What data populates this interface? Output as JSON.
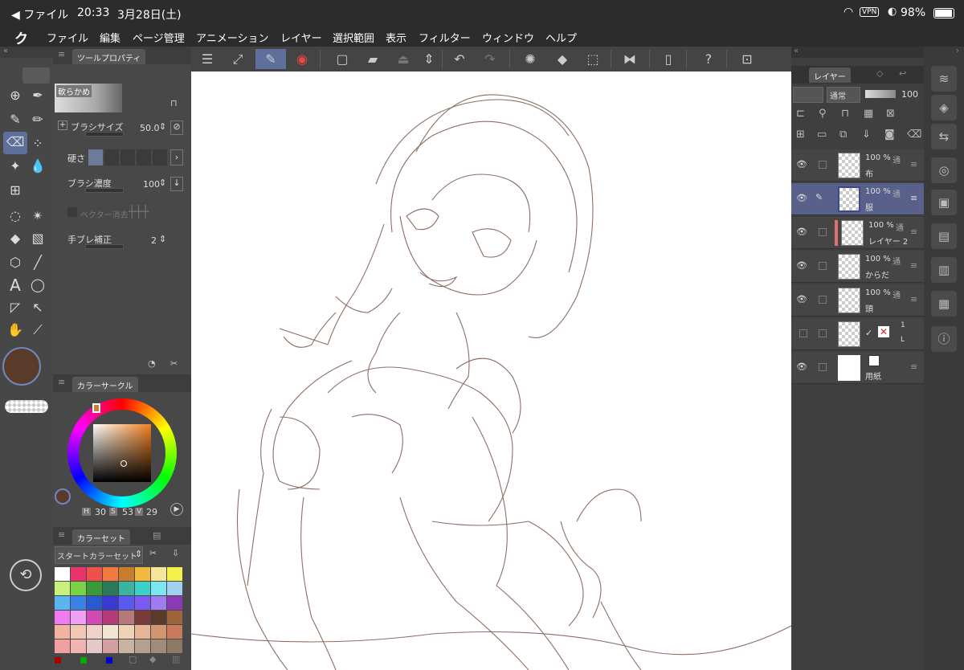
{
  "status": {
    "back": "◀ ファイル",
    "time": "20:33",
    "date": "3月28日(土)",
    "vpn": "VPN",
    "battery": "98%"
  },
  "menu": [
    "ファイル",
    "編集",
    "ページ管理",
    "アニメーション",
    "レイヤー",
    "選択範囲",
    "表示",
    "フィルター",
    "ウィンドウ",
    "ヘルプ"
  ],
  "tool_property": {
    "tab": "ツールプロパティ",
    "brush_name": "軟らかめ",
    "brush_size_label": "ブラシサイズ",
    "brush_size_value": "50.0",
    "hardness_label": "硬さ",
    "density_label": "ブラシ濃度",
    "density_value": "100",
    "vector_erase_label": "ベクター消去",
    "stabilize_label": "手ブレ補正",
    "stabilize_value": "2"
  },
  "color_circle": {
    "tab": "カラーサークル",
    "h_label": "H",
    "h": "30",
    "s_label": "S",
    "s": "53",
    "v_label": "V",
    "v": "29",
    "main_color": "#5a3a28",
    "sub_color": "#ffffff"
  },
  "color_set": {
    "tab": "カラーセット",
    "set_name": "スタートカラーセット"
  },
  "layers_panel": {
    "tab": "レイヤー",
    "blend_mode": "通常",
    "opacity": "100",
    "layers": [
      {
        "percent": "100 %",
        "mode": "通",
        "name": "布"
      },
      {
        "percent": "100 %",
        "mode": "通",
        "name": "服"
      },
      {
        "percent": "100 %",
        "mode": "通",
        "name": "レイヤー 2"
      },
      {
        "percent": "100 %",
        "mode": "通",
        "name": "からだ"
      },
      {
        "percent": "100 %",
        "mode": "通",
        "name": "頭"
      },
      {
        "percent": "1",
        "mode": "",
        "name": "L"
      },
      {
        "percent": "",
        "mode": "",
        "name": "用紙"
      }
    ]
  },
  "palette": [
    [
      "#ffffff",
      "#e8336b",
      "#f0504a",
      "#f07a40",
      "#c87d2a",
      "#f0b83c",
      "#f5e69b",
      "#f5f04a"
    ],
    [
      "#c8f07a",
      "#7ad24a",
      "#3a9a3a",
      "#2a7a5a",
      "#3ab4a0",
      "#3ad2c8",
      "#7ae6f0",
      "#a0d2f0"
    ],
    [
      "#5ab4f0",
      "#3a82e6",
      "#2a5ad2",
      "#3a3ad2",
      "#5a5af0",
      "#7a5af0",
      "#a07af0",
      "#8a3ab4"
    ],
    [
      "#f07af0",
      "#f0a0f0",
      "#d24ab4",
      "#b43a7a",
      "#b47a7a",
      "#7a3a3a",
      "#5a3a2a",
      "#a0643a"
    ],
    [
      "#f0b4a0",
      "#f0c8b4",
      "#f0d2c8",
      "#f0e6d2",
      "#f0d2b4",
      "#e6b496",
      "#d2966e",
      "#c87a5a"
    ],
    [
      "#f0a0a0",
      "#f0b4b4",
      "#e6c8c8",
      "#d2a0a0",
      "#c8b4a0",
      "#b4a08c",
      "#a08c78",
      "#8c7864"
    ]
  ]
}
